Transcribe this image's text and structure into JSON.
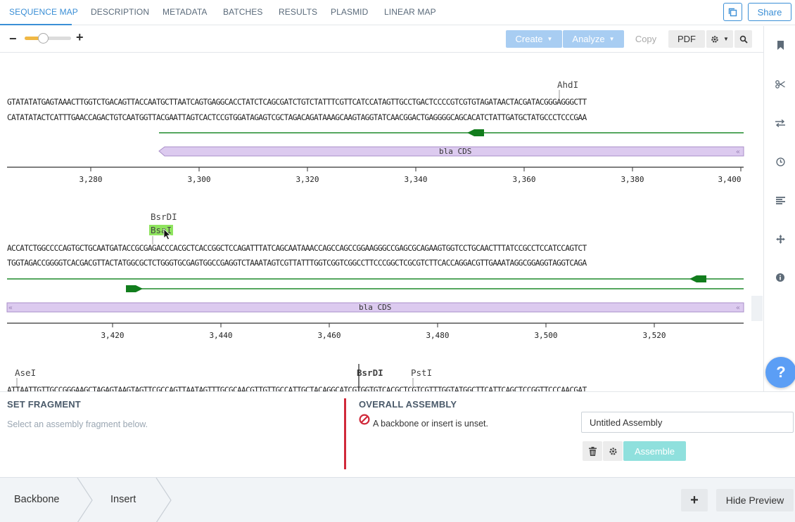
{
  "tabs": [
    {
      "label": "SEQUENCE MAP",
      "active": true
    },
    {
      "label": "DESCRIPTION"
    },
    {
      "label": "METADATA"
    },
    {
      "label": "BATCHES"
    },
    {
      "label": "RESULTS"
    },
    {
      "label": "PLASMID"
    },
    {
      "label": "LINEAR MAP"
    }
  ],
  "header": {
    "copy_icon": "copy-icon",
    "share_label": "Share"
  },
  "toolbar": {
    "zoom_minus": "−",
    "zoom_plus": "+",
    "zoom_level": 0.4,
    "create_label": "Create",
    "analyze_label": "Analyze",
    "copy_label": "Copy",
    "pdf_label": "PDF",
    "settings_icon": "gear-icon",
    "search_icon": "search-icon"
  },
  "rail_icons": [
    "bookmark-icon",
    "scissors-icon",
    "swap-icon",
    "history-icon",
    "align-left-icon",
    "move-icon",
    "info-icon"
  ],
  "help_label": "?",
  "sequence": {
    "rows": [
      {
        "top": "GTATATATGAGTAAACTTGGTCTGACAGTTACCAATGCTTAATCAGTGAGGCACCTATCTCAGCGATCTGTCTATTTCGTTCATCCATAGTTGCCTGACTCCCCGTCGTGTAGATAACTACGATACGGGAGGGCTT",
        "bottom": "CATATATACTCATTTGAACCAGACTGTCAATGGTTACGAATTAGTCACTCCGTGGATAGAGTCGCTAGACAGATAAAGCAAGTAGGTATCAACGGACTGAGGGGCAGCACATCTATTGATGCTATGCCCTCCCGAA",
        "sites": [
          {
            "name": "AhdI"
          }
        ],
        "feature_label": "bla CDS",
        "ticks": [
          "3,280",
          "3,300",
          "3,320",
          "3,340",
          "3,360",
          "3,380",
          "3,400"
        ]
      },
      {
        "top": "ACCATCTGGCCCCAGTGCTGCAATGATACCGCGAGACCCACGCTCACCGGCTCCAGATTTATCAGCAATAAACCAGCCAGCCGGAAGGGCCGAGCGCAGAAGTGGTCCTGCAACTTTATCCGCCTCCATCCAGTCT",
        "bottom": "TGGTAGACCGGGGTCACGACGTTACTATGGCGCTCTGGGTGCGAGTGGCCGAGGTCTAAATAGTCGTTATTTGGTCGGTCGGCCTTCCCGGCTCGCGTCTTCACCAGGACGTTGAAATAGGCGGAGGTAGGTCAGA",
        "sites": [
          {
            "name": "BsrDI"
          },
          {
            "name": "BsaI"
          }
        ],
        "feature_label": "bla CDS",
        "ticks": [
          "3,420",
          "3,440",
          "3,460",
          "3,480",
          "3,500",
          "3,520"
        ]
      },
      {
        "top": "ATTAATTGTTGCCGGGAAGCTAGAGTAAGTAGTTCGCCAGTTAATAGTTTGCGCAACGTTGTTGCCATTGCTACAGGCATCGTGGTGTCACGCTCGTCGTTTGGTATGGCTTCATTCAGCTCCGGTTCCCAACGAT",
        "sites": [
          {
            "name": "AseI"
          },
          {
            "name": "BsrDI"
          },
          {
            "name": "PstI"
          }
        ]
      }
    ]
  },
  "set_fragment": {
    "title": "SET FRAGMENT",
    "hint": "Select an assembly fragment below."
  },
  "overall_assembly": {
    "title": "OVERALL ASSEMBLY",
    "warning": "A backbone or insert is unset.",
    "name_value": "Untitled Assembly",
    "delete_icon": "trash-icon",
    "settings_icon": "gear-icon",
    "assemble_label": "Assemble"
  },
  "footer": {
    "crumbs": [
      "Backbone",
      "Insert"
    ],
    "add_label": "+",
    "hide_preview_label": "Hide Preview"
  }
}
